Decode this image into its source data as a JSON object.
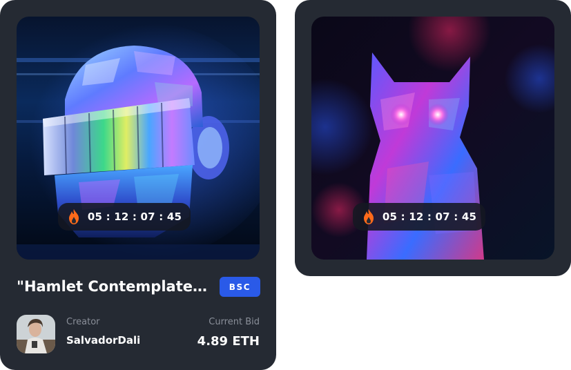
{
  "cards": [
    {
      "artwork": "daft-punk-crystal-helmet",
      "timer": "05 : 12 : 07 : 45",
      "title": "\"Hamlet Contemplates ...",
      "chain_badge": "BSC",
      "creator_label": "Creator",
      "creator_name": "SalvadorDali",
      "bid_label": "Current Bid",
      "bid_value": "4.89 ETH"
    },
    {
      "artwork": "crystal-cat",
      "timer": "05 : 12 : 07 : 45"
    }
  ],
  "colors": {
    "card_bg": "#252a33",
    "badge_bg": "#2a5ae8",
    "muted_text": "#8a8f99",
    "flame": "#ff6a1a"
  }
}
